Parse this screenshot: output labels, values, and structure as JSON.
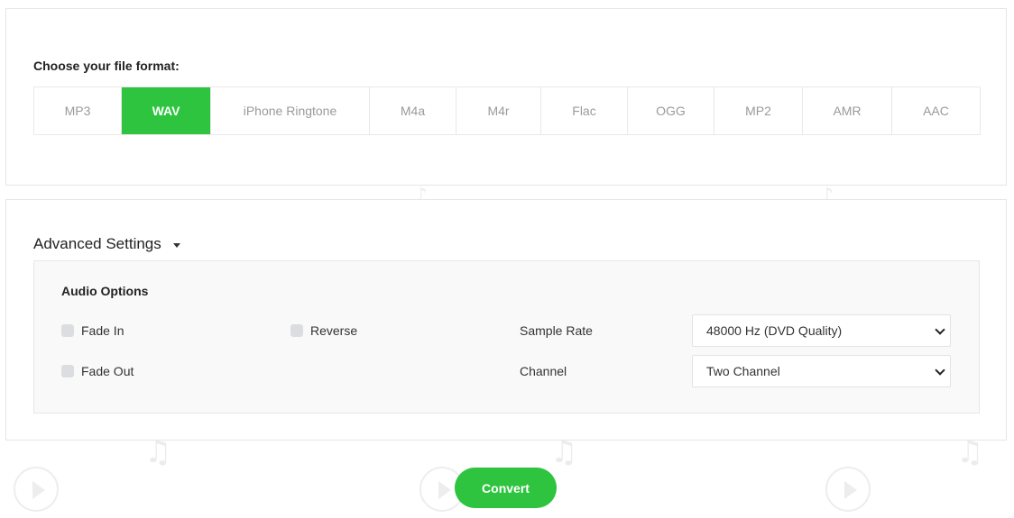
{
  "format_section": {
    "label": "Choose your file format:",
    "formats": [
      "MP3",
      "WAV",
      "iPhone Ringtone",
      "M4a",
      "M4r",
      "Flac",
      "OGG",
      "MP2",
      "AMR",
      "AAC"
    ],
    "selected": "WAV"
  },
  "advanced": {
    "title": "Advanced Settings",
    "audio_options": {
      "title": "Audio Options",
      "fade_in": {
        "label": "Fade In",
        "checked": false
      },
      "reverse": {
        "label": "Reverse",
        "checked": false
      },
      "fade_out": {
        "label": "Fade Out",
        "checked": false
      },
      "sample_rate": {
        "label": "Sample Rate",
        "value": "48000 Hz (DVD Quality)"
      },
      "channel": {
        "label": "Channel",
        "value": "Two Channel"
      }
    }
  },
  "convert_label": "Convert",
  "colors": {
    "accent": "#2ec43f",
    "inactive_text": "#9a9a9a"
  },
  "icons": [
    "caret-down-icon",
    "chevron-down-icon",
    "music-note-icon",
    "play-circle-icon"
  ]
}
